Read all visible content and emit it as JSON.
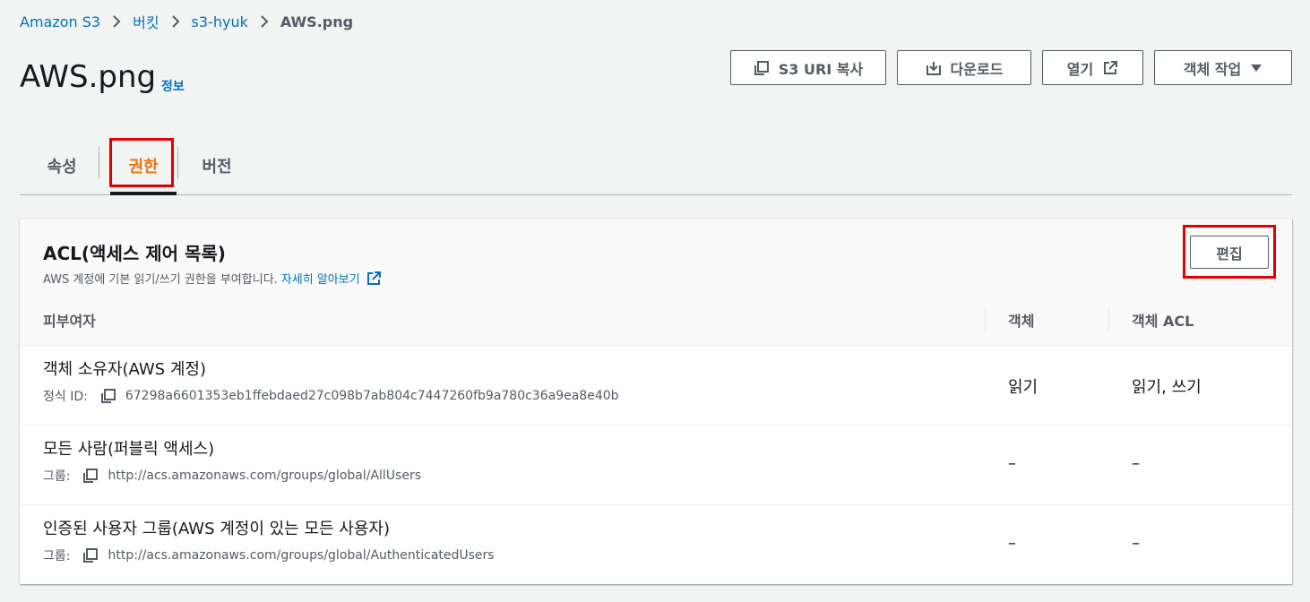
{
  "breadcrumb": {
    "items": [
      "Amazon S3",
      "버킷",
      "s3-hyuk"
    ],
    "current": "AWS.png"
  },
  "header": {
    "title": "AWS.png",
    "info": "정보"
  },
  "toolbar": {
    "copy_uri": "S3 URI 복사",
    "download": "다운로드",
    "open": "열기",
    "actions": "객체 작업"
  },
  "tabs": [
    {
      "label": "속성",
      "active": false
    },
    {
      "label": "권한",
      "active": true
    },
    {
      "label": "버전",
      "active": false
    }
  ],
  "acl": {
    "title": "ACL(액세스 제어 목록)",
    "description": "AWS 계정에 기본 읽기/쓰기 권한을 부여합니다.",
    "learn_more": "자세히 알아보기",
    "edit_label": "편집",
    "columns": {
      "grantee": "피부여자",
      "object": "객체",
      "object_acl": "객체 ACL"
    },
    "rows": [
      {
        "grantee": "객체 소유자(AWS 계정)",
        "sub_label": "정식 ID:",
        "sub_value": "67298a6601353eb1ffebdaed27c098b7ab804c7447260fb9a780c36a9ea8e40b",
        "object": "읽기",
        "object_acl": "읽기, 쓰기"
      },
      {
        "grantee": "모든 사람(퍼블릭 액세스)",
        "sub_label": "그룹:",
        "sub_value": "http://acs.amazonaws.com/groups/global/AllUsers",
        "object": "–",
        "object_acl": "–"
      },
      {
        "grantee": "인증된 사용자 그룹(AWS 계정이 있는 모든 사용자)",
        "sub_label": "그룹:",
        "sub_value": "http://acs.amazonaws.com/groups/global/AuthenticatedUsers",
        "object": "–",
        "object_acl": "–"
      }
    ]
  },
  "colors": {
    "link": "#0073bb",
    "active_tab": "#ec7211",
    "highlight": "#e00000"
  }
}
